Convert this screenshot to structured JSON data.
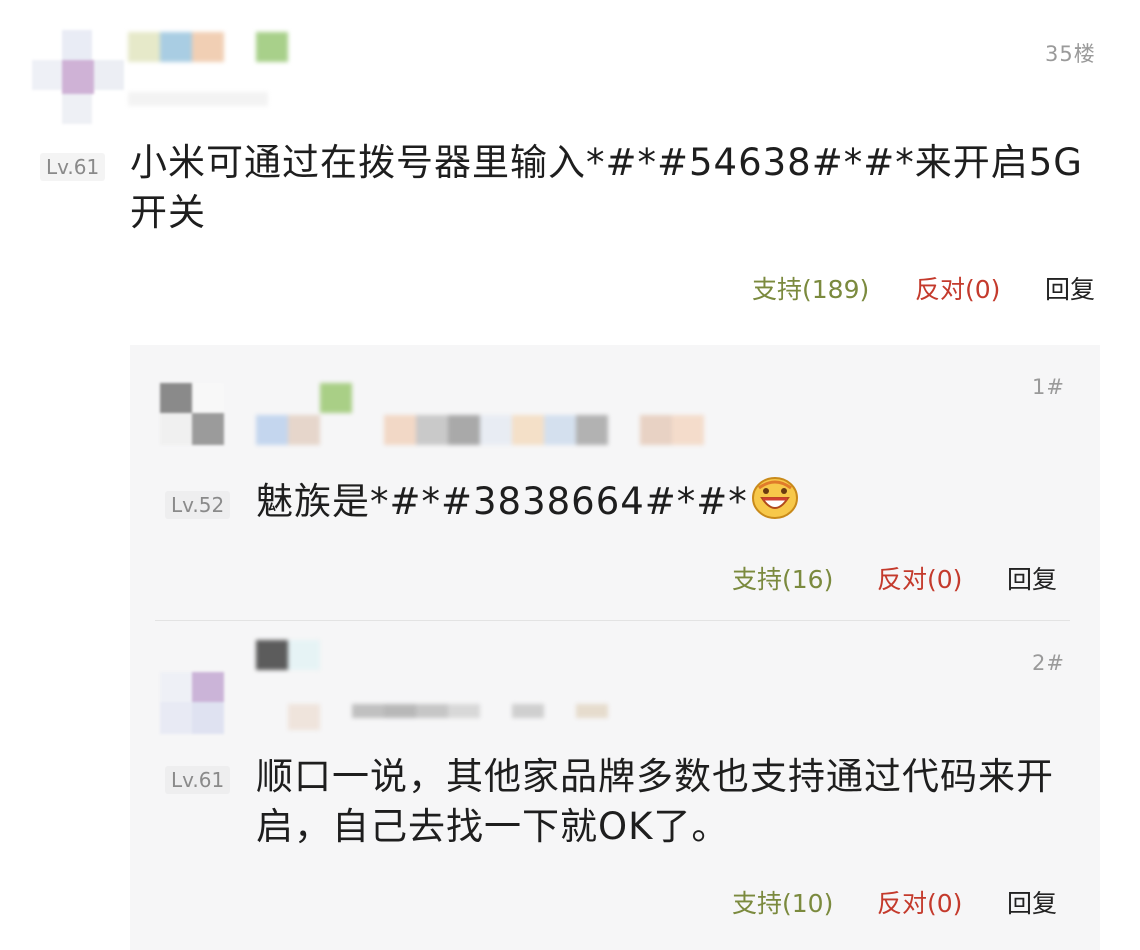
{
  "main": {
    "floor": "35楼",
    "level": "Lv.61",
    "comment": "小米可通过在拨号器里输入*#*#54638#*#*来开启5G开关",
    "support": "支持(189)",
    "oppose": "反对(0)",
    "reply": "回复"
  },
  "replies": [
    {
      "floor": "1#",
      "level": "Lv.52",
      "comment": "魅族是*#*#3838664#*#*",
      "emoji": "grinning-emoji-icon",
      "support": "支持(16)",
      "oppose": "反对(0)",
      "reply": "回复"
    },
    {
      "floor": "2#",
      "level": "Lv.61",
      "comment": "顺口一说，其他家品牌多数也支持通过代码来开启，自己去找一下就OK了。",
      "support": "支持(10)",
      "oppose": "反对(0)",
      "reply": "回复"
    }
  ],
  "colors": {
    "support": "#7b8a3e",
    "oppose": "#c43a2c",
    "reply_bg": "#f6f6f7"
  }
}
